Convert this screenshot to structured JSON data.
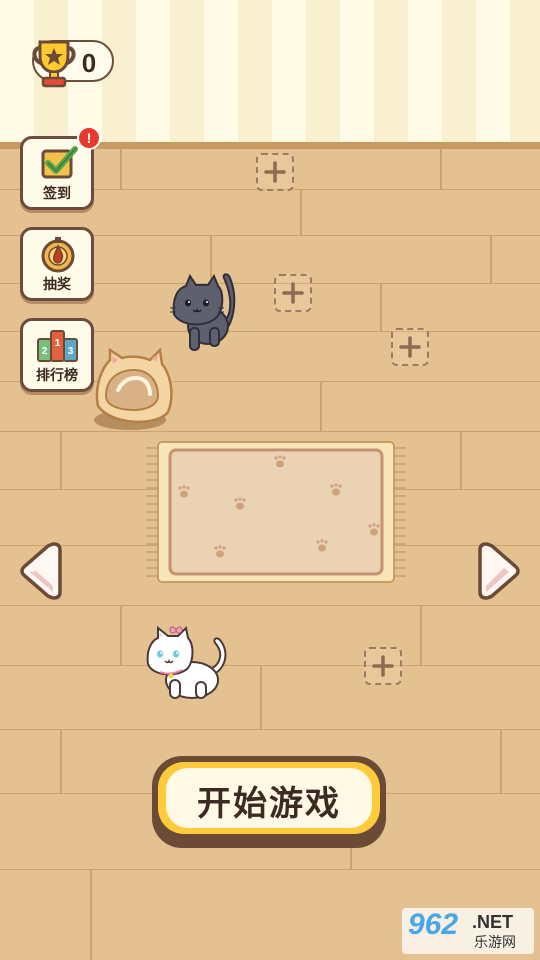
{
  "trophy": {
    "count": "0"
  },
  "side_menu": [
    {
      "id": "checkin",
      "label": "签到",
      "icon": "checkbox-check-icon",
      "badge": "!"
    },
    {
      "id": "lottery",
      "label": "抽奖",
      "icon": "lottery-coin-icon"
    },
    {
      "id": "ranking",
      "label": "排行榜",
      "icon": "podium-cards-icon",
      "ranks": [
        "2",
        "1",
        "3"
      ]
    }
  ],
  "start_button": {
    "label": "开始游戏"
  },
  "watermark": {
    "number": "962",
    "suffix": ".NET",
    "site": "乐游网"
  },
  "colors": {
    "wall": "#fffbe7",
    "floor": "#e4c190",
    "accent_yellow": "#ffcb3a",
    "outline_brown": "#6b4a36",
    "badge_red": "#e53a2c"
  }
}
